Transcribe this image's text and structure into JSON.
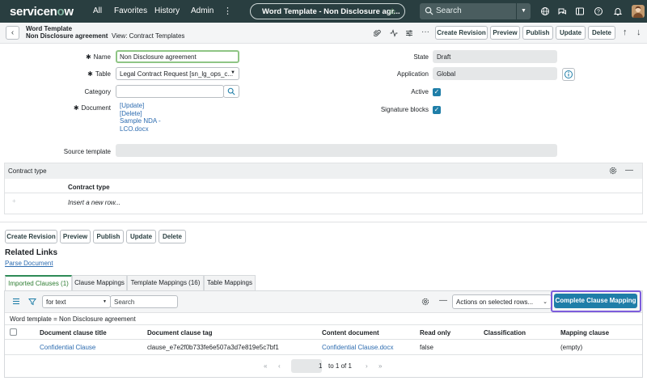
{
  "app": {
    "logo": {
      "prefix": "servicen",
      "o": "o",
      "suffix": "w"
    },
    "nav": [
      "All",
      "Favorites",
      "History",
      "Admin"
    ],
    "record_pill": "Word Template - Non Disclosure agr...",
    "search_placeholder": "Search"
  },
  "header": {
    "type": "Word Template",
    "name": "Non Disclosure agreement",
    "view": "View: Contract Templates",
    "buttons": [
      "Create Revision",
      "Preview",
      "Publish",
      "Update",
      "Delete"
    ]
  },
  "form": {
    "name_label": "Name",
    "name_value": "Non Disclosure agreement",
    "table_label": "Table",
    "table_value": "Legal Contract Request [sn_lg_ops_c...",
    "category_label": "Category",
    "category_value": "",
    "document_label": "Document",
    "document_links": [
      "[Update]",
      "[Delete]",
      "Sample NDA -",
      "LCO.docx"
    ],
    "source_template_label": "Source template",
    "source_template_value": "",
    "state_label": "State",
    "state_value": "Draft",
    "application_label": "Application",
    "application_value": "Global",
    "active_label": "Active",
    "active_checked": true,
    "signature_label": "Signature blocks",
    "signature_checked": true
  },
  "contract_type": {
    "title": "Contract type",
    "column": "Contract type",
    "insert_row": "Insert a new row..."
  },
  "bottom_buttons": [
    "Create Revision",
    "Preview",
    "Publish",
    "Update",
    "Delete"
  ],
  "related": {
    "title": "Related Links",
    "link": "Parse Document"
  },
  "tabs": [
    "Imported Clauses (1)",
    "Clause Mappings",
    "Template Mappings (16)",
    "Table Mappings"
  ],
  "list": {
    "filter_select": "for text",
    "search_placeholder": "Search",
    "actions_select": "Actions on selected rows...",
    "complete_button": "Complete Clause Mapping",
    "breadcrumb": "Word template = Non Disclosure agreement",
    "columns": [
      "Document clause title",
      "Document clause tag",
      "Content document",
      "Read only",
      "Classification",
      "Mapping clause"
    ],
    "rows": [
      [
        "Confidential Clause",
        "clause_e7e2f0b733fe6e507a3d7e819e5c7bf1",
        "Confidential Clause.docx",
        "false",
        "",
        "(empty)"
      ]
    ],
    "pager": "to 1 of 1",
    "pager_value": "1"
  },
  "colors": {
    "nav_bg": "#293e40",
    "primary": "#1f7ea8",
    "highlight": "#7c5cdc"
  }
}
